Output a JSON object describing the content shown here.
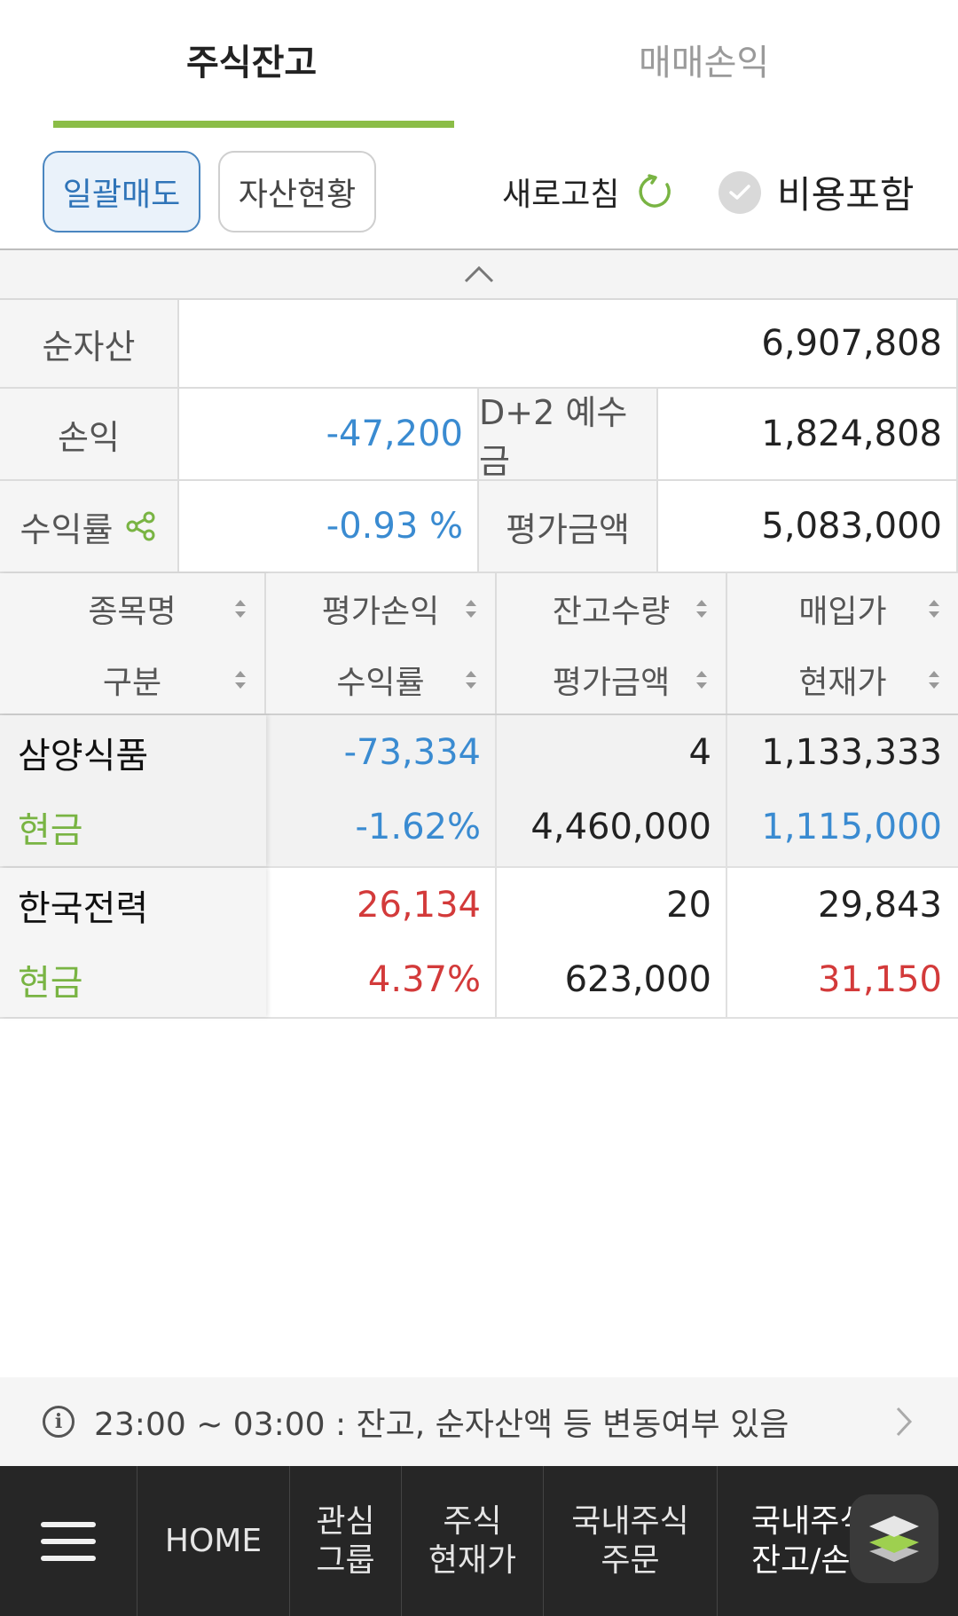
{
  "tabs": [
    {
      "label": "주식잔고",
      "active": true
    },
    {
      "label": "매매손익",
      "active": false
    }
  ],
  "toolbar": {
    "bulk_sell": "일괄매도",
    "asset_status": "자산현황",
    "refresh": "새로고침",
    "include_fee": "비용포함"
  },
  "summary": {
    "net_asset_label": "순자산",
    "net_asset_value": "6,907,808",
    "pnl_label": "손익",
    "pnl_value": "-47,200",
    "deposit_label": "D+2 예수금",
    "deposit_value": "1,824,808",
    "return_label": "수익률",
    "return_value": "-0.93 %",
    "eval_amount_label": "평가금액",
    "eval_amount_value": "5,083,000"
  },
  "holdings_header": {
    "col1_top": "종목명",
    "col1_bottom": "구분",
    "col2_top": "평가손익",
    "col2_bottom": "수익률",
    "col3_top": "잔고수량",
    "col3_bottom": "평가금액",
    "col4_top": "매입가",
    "col4_bottom": "현재가"
  },
  "holdings": [
    {
      "name": "삼양식품",
      "type": "현금",
      "pnl": "-73,334",
      "return": "-1.62%",
      "qty": "4",
      "eval": "4,460,000",
      "buy_price": "1,133,333",
      "cur_price": "1,115,000"
    },
    {
      "name": "한국전력",
      "type": "현금",
      "pnl": "26,134",
      "return": "4.37%",
      "qty": "20",
      "eval": "623,000",
      "buy_price": "29,843",
      "cur_price": "31,150"
    }
  ],
  "info": {
    "text": "23:00 ~ 03:00 : 잔고, 순자산액 등 변동여부 있음"
  },
  "nav": {
    "home": "HOME",
    "watch_l1": "관심",
    "watch_l2": "그룹",
    "price_l1": "주식",
    "price_l2": "현재가",
    "order_l1": "국내주식",
    "order_l2": "주문",
    "balance_l1": "국내주식",
    "balance_l2": "잔고/손"
  },
  "colors": {
    "accent_green": "#8bbd47",
    "loss_blue": "#3a8bd1",
    "gain_red": "#d33a3a",
    "nav_bg": "#262626"
  }
}
